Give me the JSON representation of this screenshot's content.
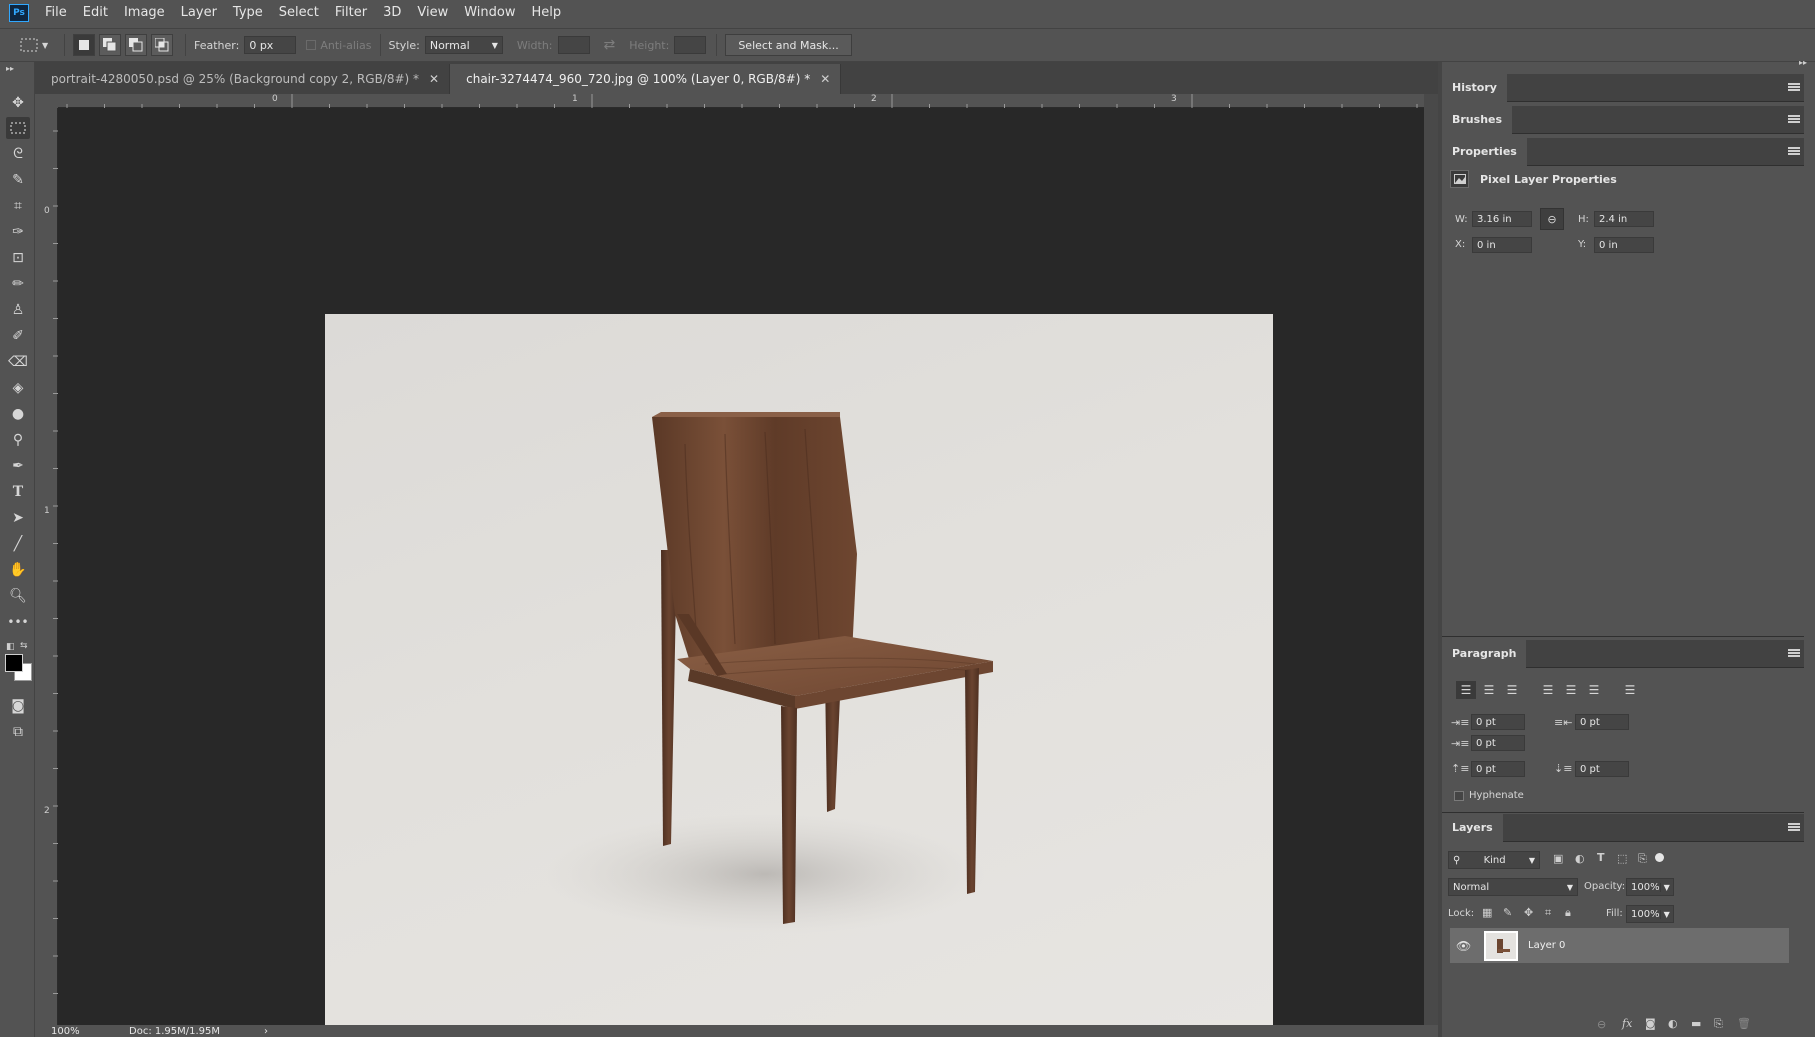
{
  "menubar": {
    "logo": "Ps",
    "items": [
      "File",
      "Edit",
      "Image",
      "Layer",
      "Type",
      "Select",
      "Filter",
      "3D",
      "View",
      "Window",
      "Help"
    ]
  },
  "options": {
    "feather_label": "Feather:",
    "feather_value": "0 px",
    "antialias_label": "Anti-alias",
    "style_label": "Style:",
    "style_value": "Normal",
    "width_label": "Width:",
    "height_label": "Height:",
    "select_mask_label": "Select and Mask..."
  },
  "tabs": [
    {
      "label": "portrait-4280050.psd @ 25% (Background copy 2, RGB/8#) *",
      "active": false
    },
    {
      "label": "chair-3274474_960_720.jpg @ 100% (Layer 0, RGB/8#) *",
      "active": true
    }
  ],
  "rulers": {
    "top": [
      "0",
      "1",
      "2",
      "3"
    ],
    "left": [
      "0",
      "1",
      "2"
    ]
  },
  "status": {
    "zoom": "100%",
    "doc": "Doc: 1.95M/1.95M"
  },
  "panels": {
    "history": "History",
    "brushes": "Brushes",
    "properties": {
      "title": "Properties",
      "subtitle": "Pixel Layer Properties",
      "w_label": "W:",
      "w_value": "3.16 in",
      "h_label": "H:",
      "h_value": "2.4 in",
      "x_label": "X:",
      "x_value": "0 in",
      "y_label": "Y:",
      "y_value": "0 in"
    },
    "paragraph": {
      "title": "Paragraph",
      "indent_left": "0 pt",
      "indent_right": "0 pt",
      "indent_first": "0 pt",
      "space_before": "0 pt",
      "space_after": "0 pt",
      "hyphenate": "Hyphenate"
    },
    "layers": {
      "title": "Layers",
      "kind": "Kind",
      "blend": "Normal",
      "opacity_label": "Opacity:",
      "opacity": "100%",
      "lock_label": "Lock:",
      "fill_label": "Fill:",
      "fill": "100%",
      "layer_name": "Layer 0"
    }
  },
  "colors": {
    "ui_bg": "#535353",
    "canvas_bg": "#282828",
    "accent": "#31a8ff",
    "wood": "#6b4530"
  }
}
